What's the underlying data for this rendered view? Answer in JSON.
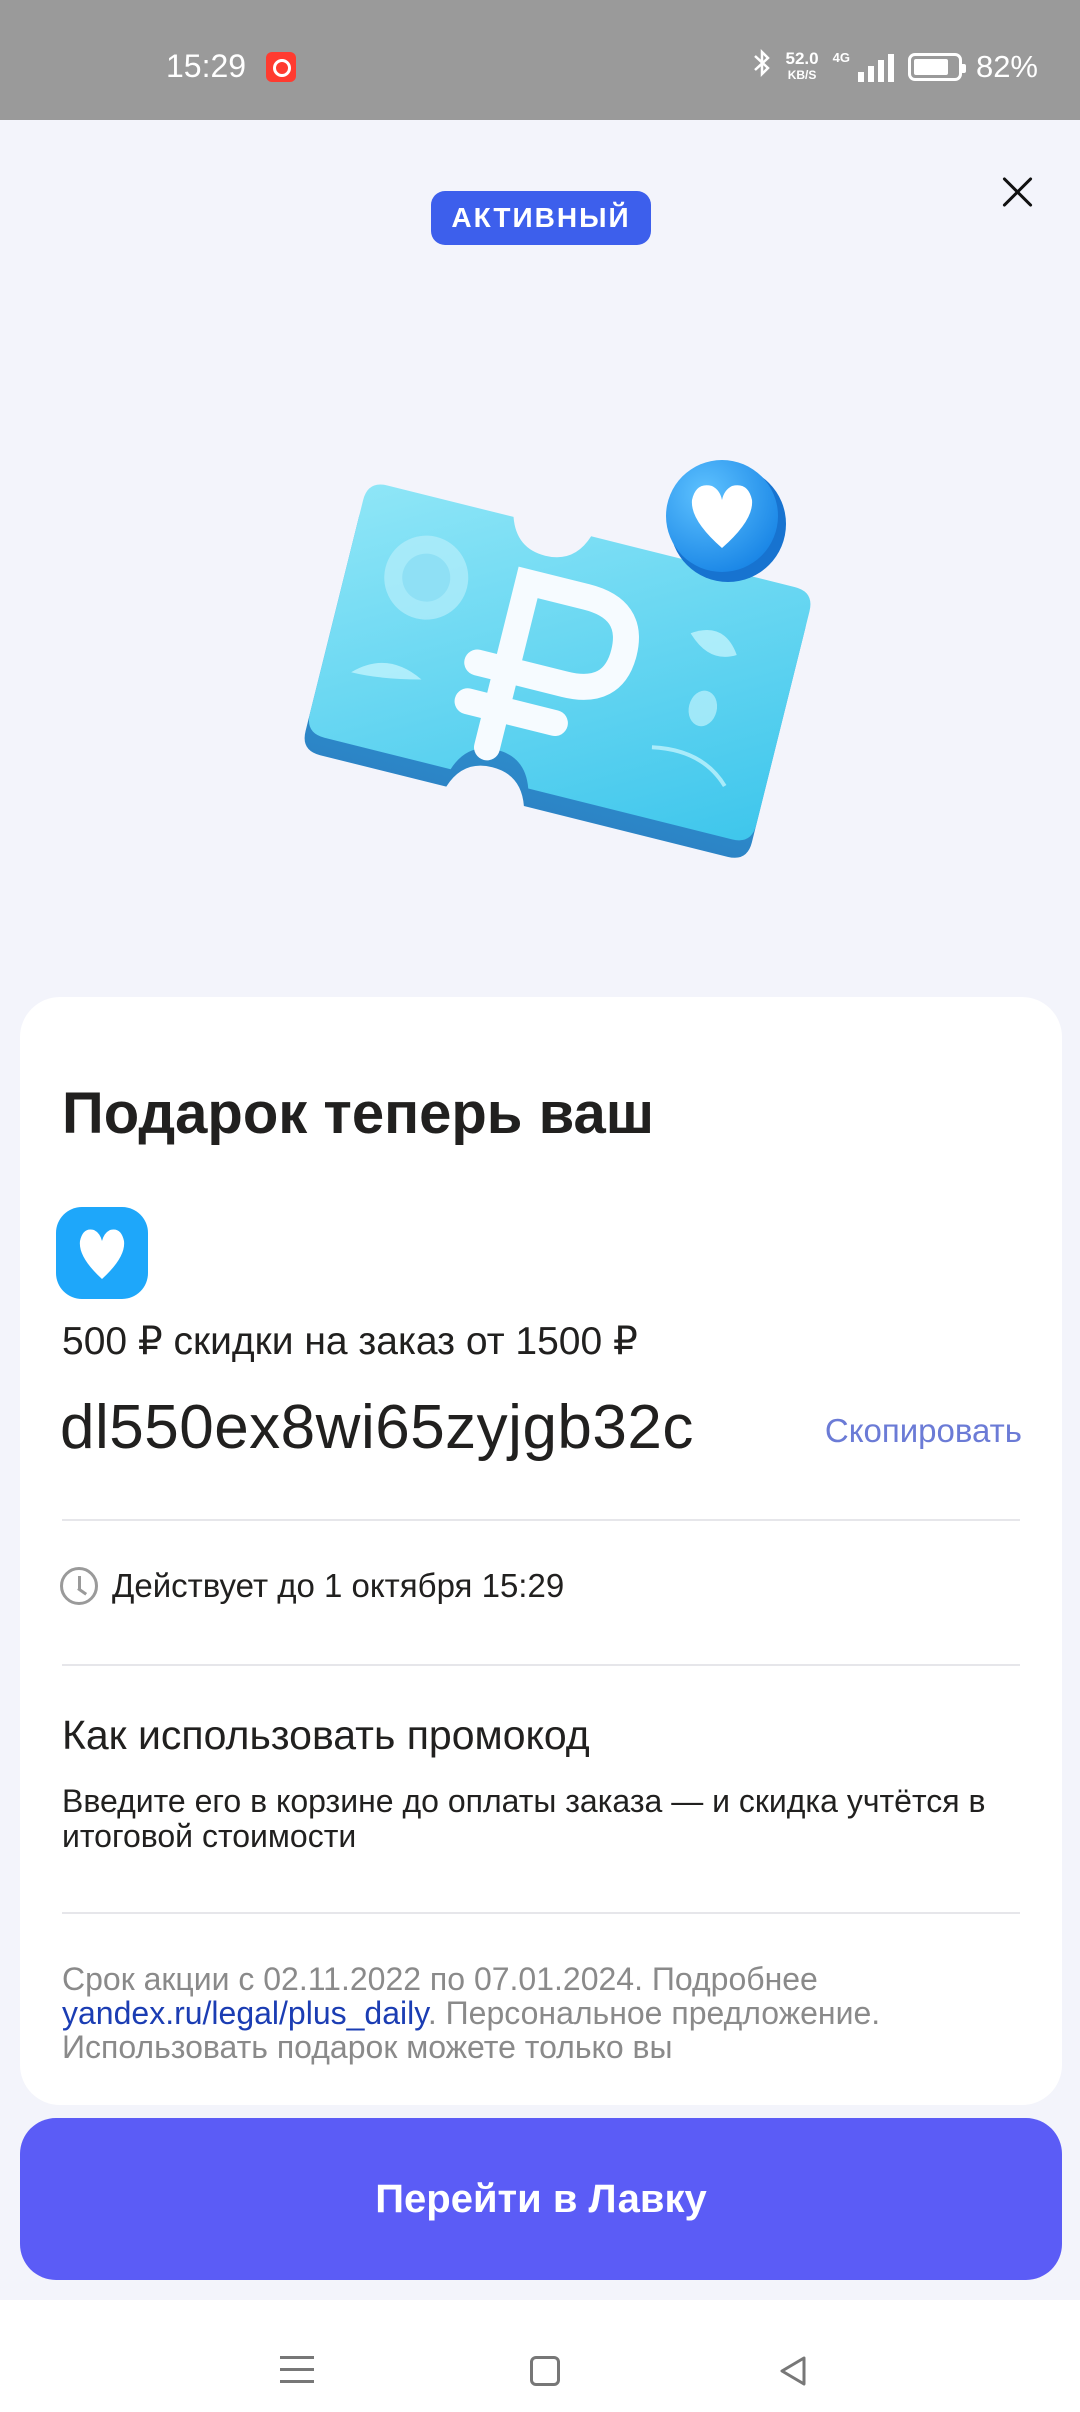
{
  "status_bar": {
    "time": "15:29",
    "net_speed_value": "52.0",
    "net_speed_unit": "KB/S",
    "network_type": "4G",
    "battery": "82%",
    "battery_level": 0.82,
    "icons": [
      "alert-icon",
      "bluetooth-icon",
      "signal-icon",
      "battery-icon"
    ]
  },
  "header": {
    "badge": "АКТИВНЫЙ",
    "accent_color": "#3d5fec"
  },
  "card": {
    "title": "Подарок теперь ваш",
    "promo_desc": "500 ₽ скидки на заказ от 1500 ₽",
    "promo_code": "dl550ex8wi65zyjgb32c",
    "copy_label": "Скопировать",
    "valid_until": "Действует до 1 октября 15:29",
    "howto_title": "Как использовать промокод",
    "howto_text": "Введите его в корзине до оплаты заказа — и скидка учтётся в итоговой стоимости",
    "legal_prefix": "Срок акции с 02.11.2022 по 07.01.2024. Подробнее ",
    "legal_link": "yandex.ru/legal/plus_daily",
    "legal_suffix": ". Персональное предложение. Использовать подарок можете только вы"
  },
  "actions": {
    "main_button": "Перейти в Лавку",
    "button_color": "#5b5cf6"
  },
  "nav": {
    "icons": [
      "menu-icon",
      "home-icon",
      "back-icon"
    ]
  }
}
